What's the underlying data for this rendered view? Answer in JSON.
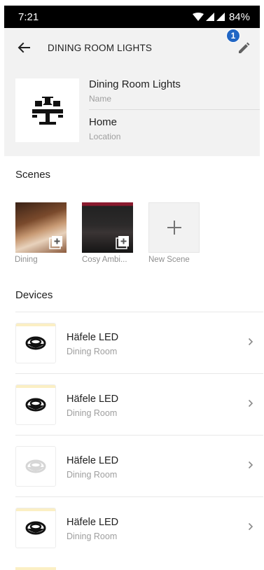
{
  "status_bar": {
    "time": "7:21",
    "battery": "84%"
  },
  "app_bar": {
    "title": "DINING ROOM LIGHTS",
    "badge_count": "1"
  },
  "room": {
    "name": "Dining Room Lights",
    "name_label": "Name",
    "location": "Home",
    "location_label": "Location",
    "icon": "dining-table-lamp-icon"
  },
  "scenes": {
    "title": "Scenes",
    "items": [
      {
        "label": "Dining"
      },
      {
        "label": "Cosy Ambi..."
      },
      {
        "label": "New Scene"
      }
    ]
  },
  "devices": {
    "title": "Devices",
    "items": [
      {
        "name": "Häfele LED",
        "room": "Dining Room",
        "on": true
      },
      {
        "name": "Häfele LED",
        "room": "Dining Room",
        "on": true
      },
      {
        "name": "Häfele LED",
        "room": "Dining Room",
        "on": false
      },
      {
        "name": "Häfele LED",
        "room": "Dining Room",
        "on": true
      }
    ]
  },
  "colors": {
    "accent_badge": "#2166c4",
    "header_bg": "#f2f2f2",
    "light_on_glow": "#fbefc4"
  }
}
